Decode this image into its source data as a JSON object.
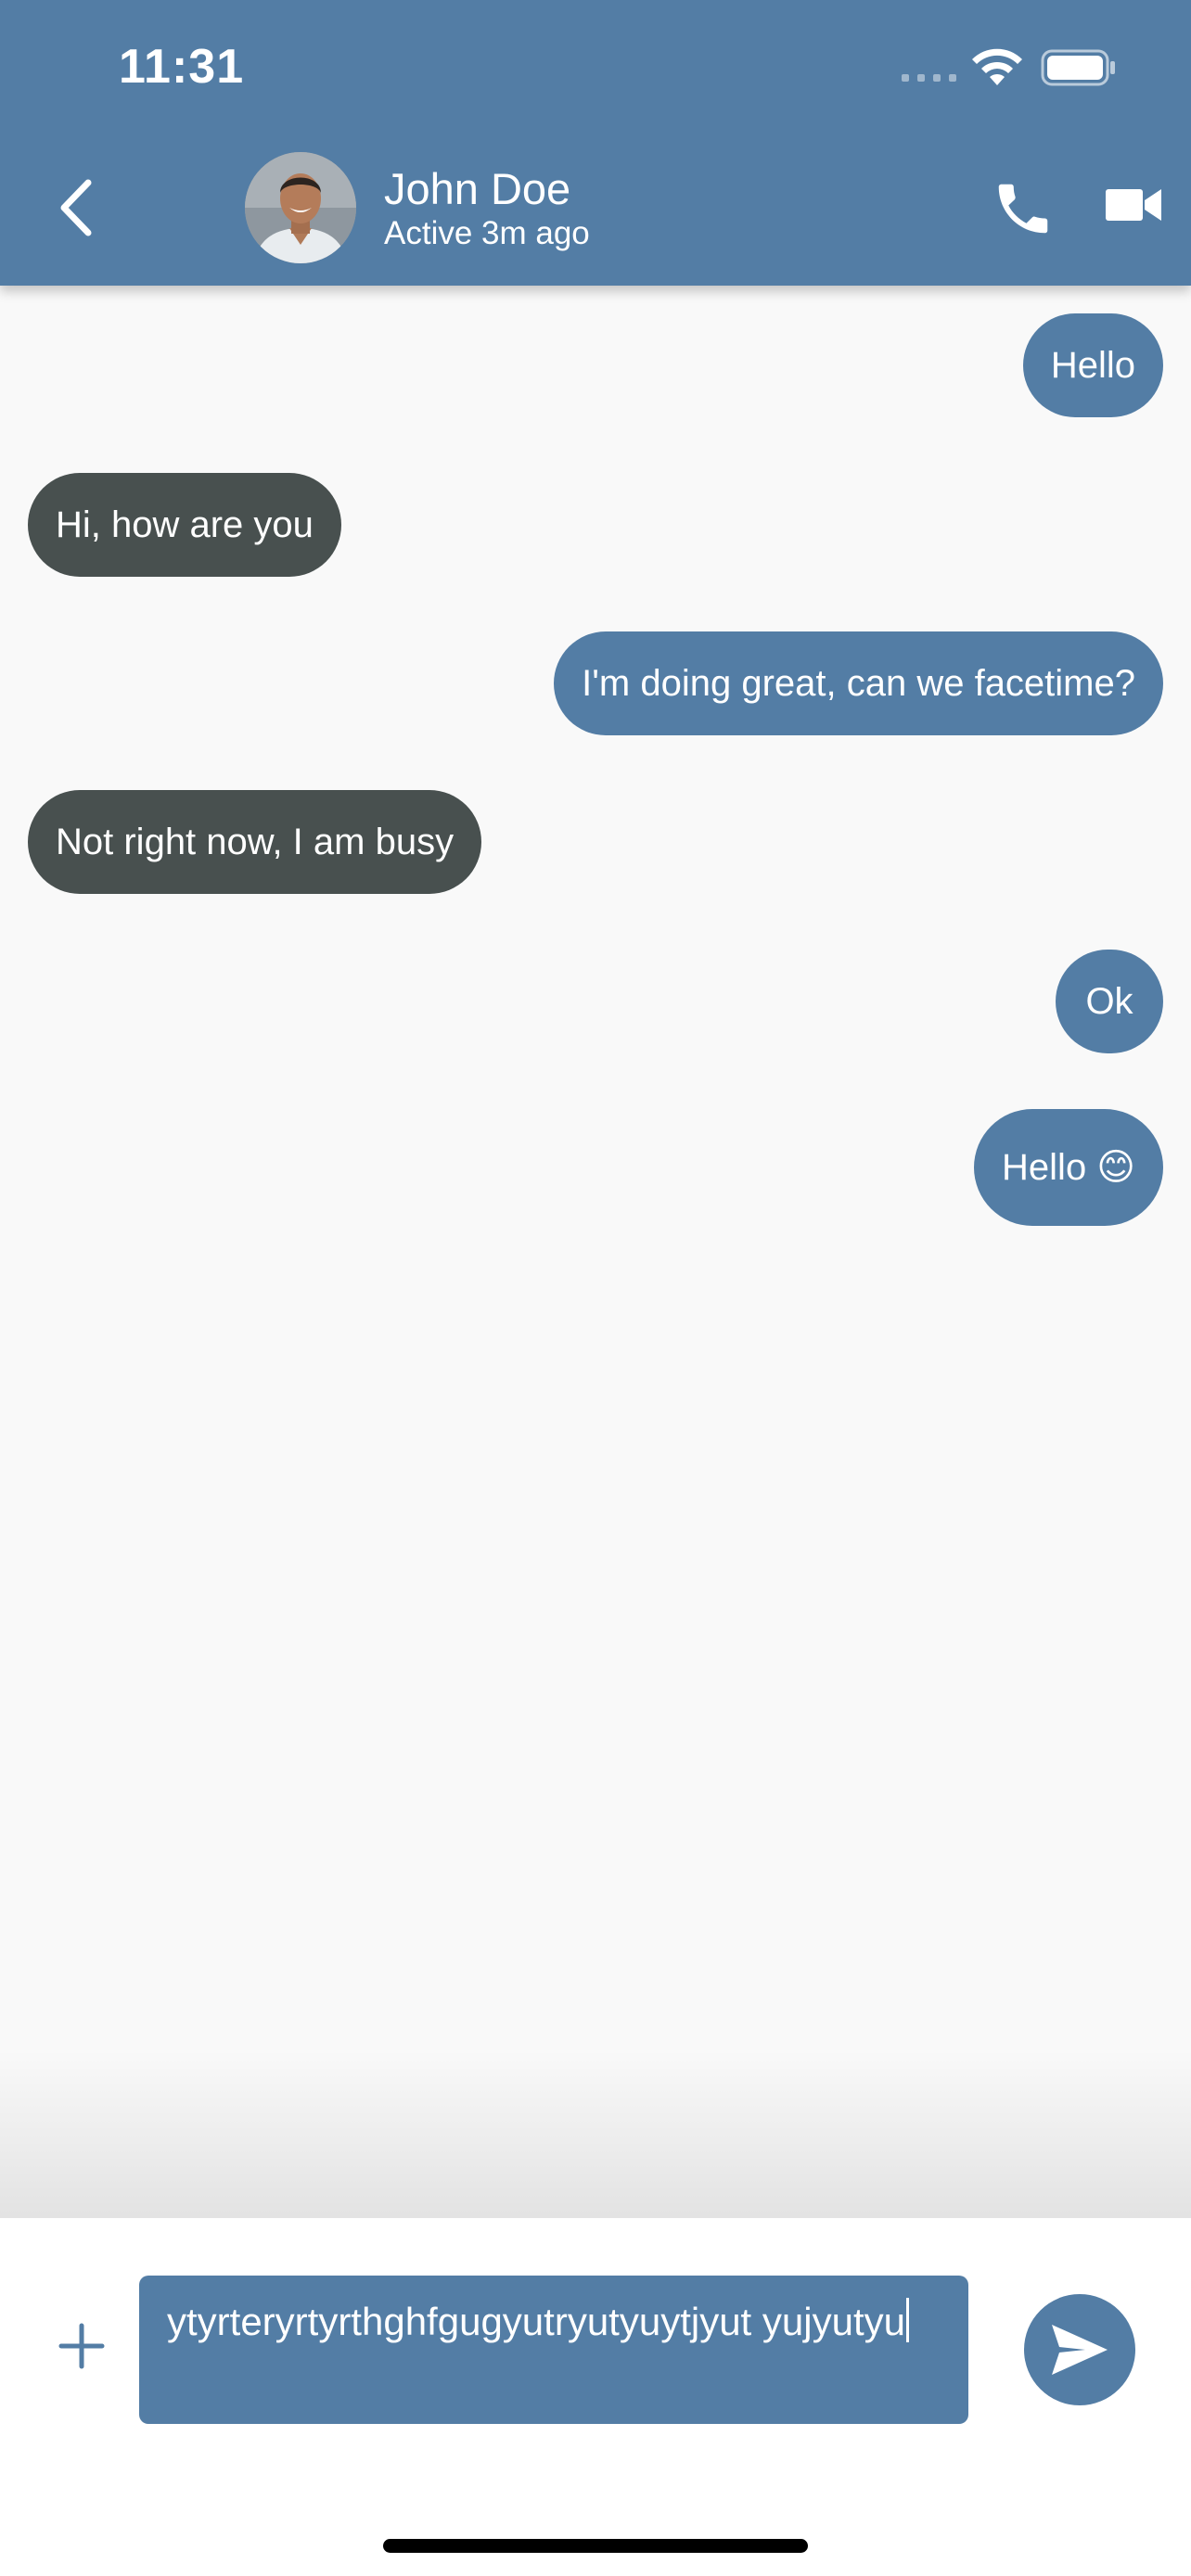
{
  "status_bar": {
    "time": "11:31"
  },
  "header": {
    "contact_name": "John Doe",
    "contact_status": "Active 3m ago",
    "icons": {
      "back": "chevron-left-icon",
      "call": "phone-icon",
      "video": "video-camera-icon"
    }
  },
  "messages": [
    {
      "direction": "outgoing",
      "text": "Hello"
    },
    {
      "direction": "incoming",
      "text": "Hi, how are you"
    },
    {
      "direction": "outgoing",
      "text": "I'm doing great, can we facetime?"
    },
    {
      "direction": "incoming",
      "text": "Not right now, I am busy"
    },
    {
      "direction": "outgoing",
      "text": "Ok"
    },
    {
      "direction": "outgoing",
      "text": "Hello 😊"
    }
  ],
  "composer": {
    "input_value": "ytyrteryrtyrthghfgugyutryutyuytjyut yujyutyu",
    "icons": {
      "add": "plus-icon",
      "send": "send-icon"
    }
  },
  "colors": {
    "accent": "#537da5",
    "incoming_bubble": "#48504f",
    "background": "#f9f9f9"
  }
}
